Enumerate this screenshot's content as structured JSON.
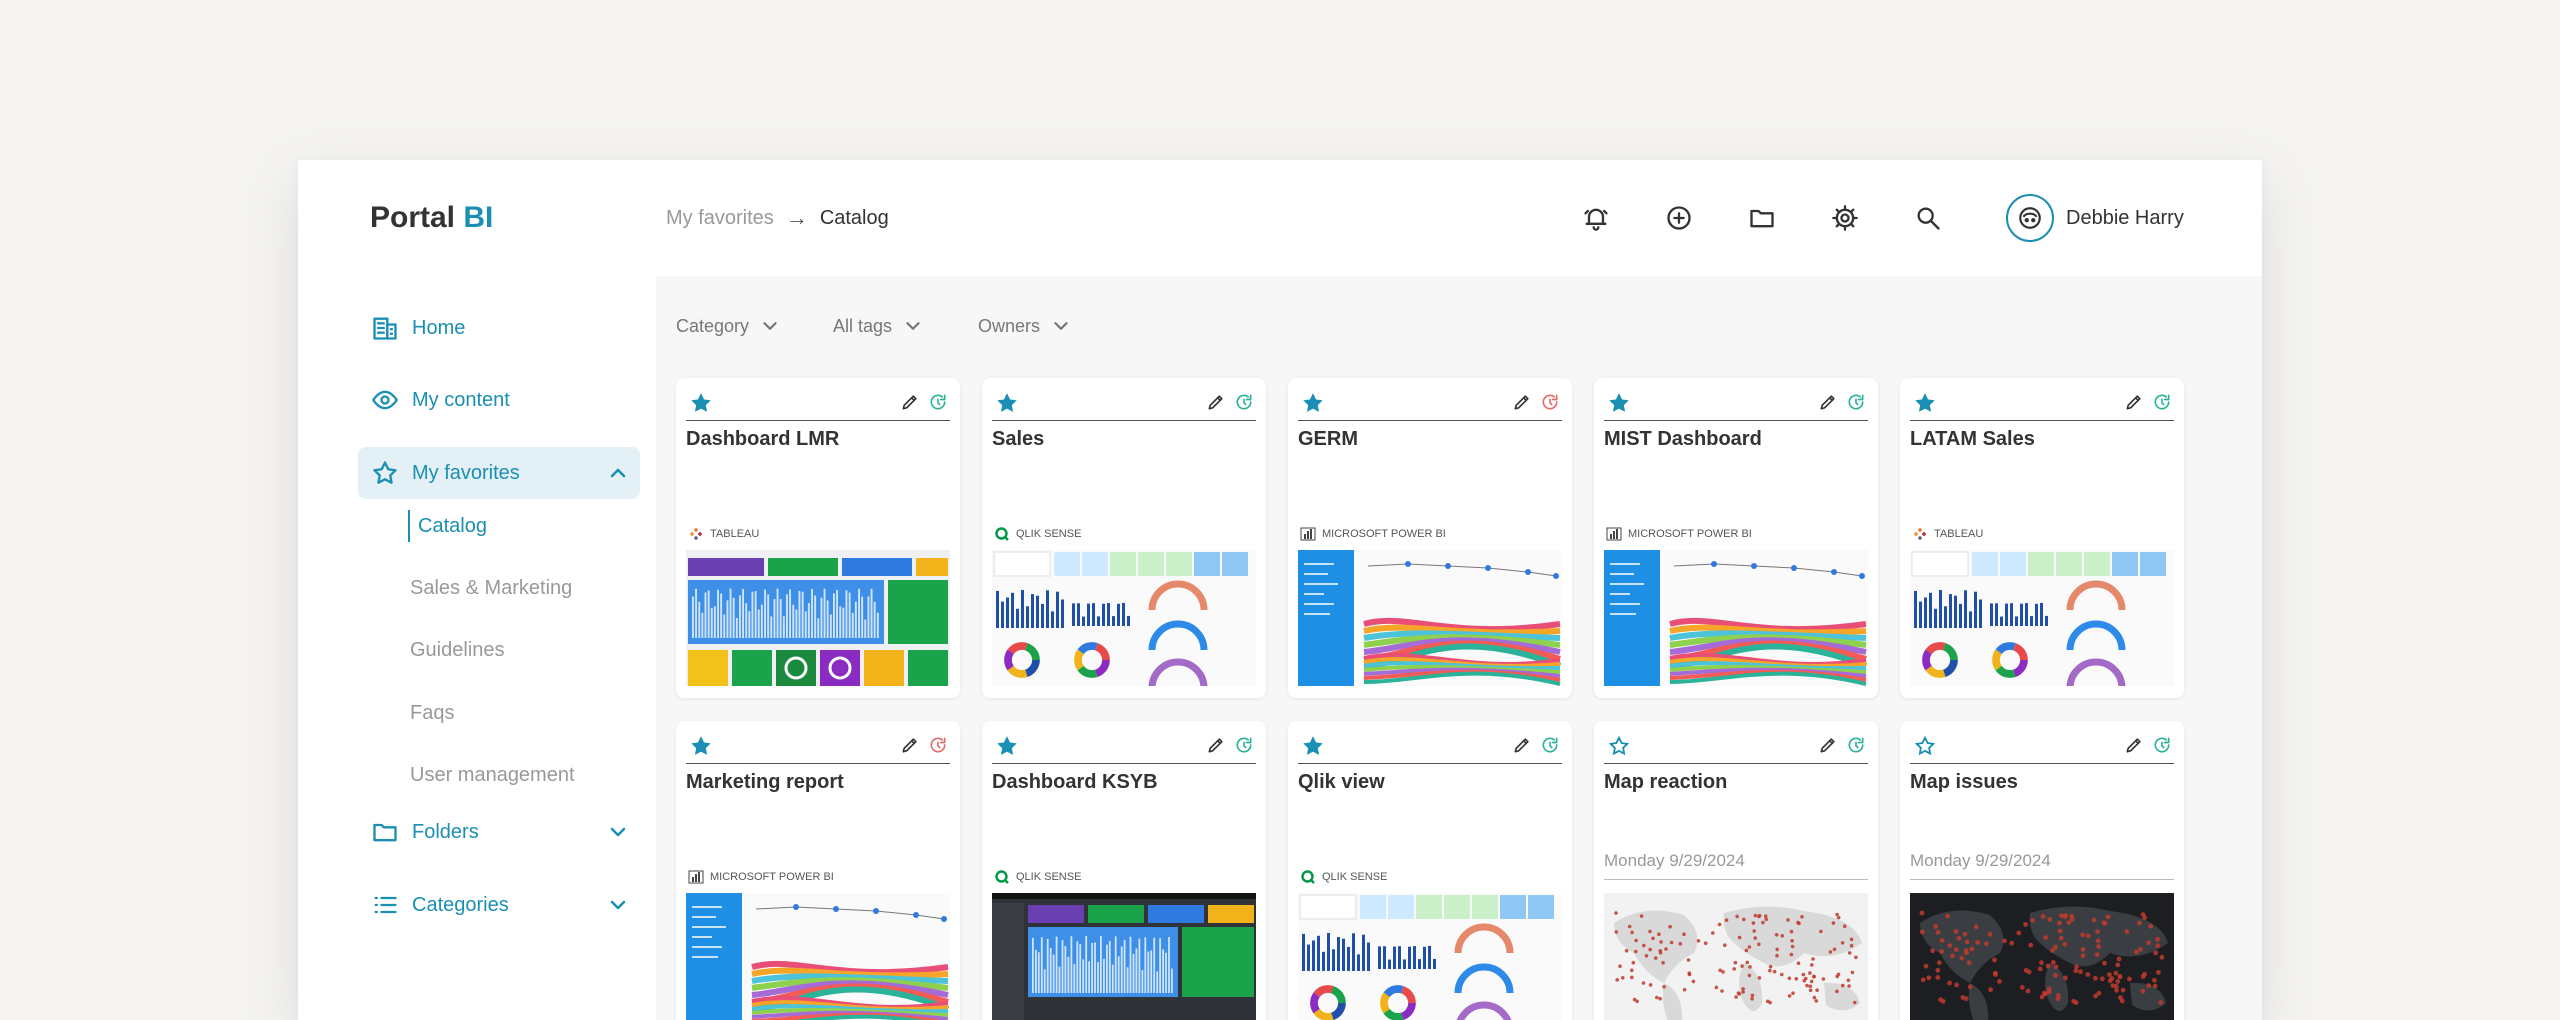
{
  "header": {
    "logo_main": "Portal",
    "logo_accent": "BI",
    "breadcrumb": {
      "parent": "My favorites",
      "arrow": "→",
      "current": "Catalog"
    },
    "user_name": "Debbie Harry"
  },
  "sidebar": {
    "home": "Home",
    "my_content": "My content",
    "my_favorites": "My favorites",
    "sub_items": [
      "Catalog",
      "Sales & Marketing",
      "Guidelines",
      "Faqs",
      "User management"
    ],
    "folders": "Folders",
    "categories": "Categories"
  },
  "filters": {
    "category": "Category",
    "tags": "All tags",
    "owners": "Owners"
  },
  "colors": {
    "accent": "#1a8fb3",
    "refresh_ok": "#2bb39a",
    "refresh_error": "#e26b6b"
  },
  "cards": [
    {
      "title": "Dashboard LMR",
      "source": "TABLEAU",
      "source_icon": "tableau-icon",
      "starred": true,
      "status": "ok",
      "thumb": "dashboard"
    },
    {
      "title": "Sales",
      "source": "QLIK SENSE",
      "source_icon": "qlik-icon",
      "starred": true,
      "status": "ok",
      "thumb": "sales"
    },
    {
      "title": "GERM",
      "source": "MICROSOFT POWER BI",
      "source_icon": "powerbi-icon",
      "starred": true,
      "status": "error",
      "thumb": "powerbi"
    },
    {
      "title": "MIST Dashboard",
      "source": "MICROSOFT POWER BI",
      "source_icon": "powerbi-icon",
      "starred": true,
      "status": "ok",
      "thumb": "powerbi"
    },
    {
      "title": "LATAM Sales",
      "source": "TABLEAU",
      "source_icon": "tableau-icon",
      "starred": true,
      "status": "ok",
      "thumb": "sales"
    },
    {
      "title": "Marketing report",
      "source": "MICROSOFT POWER BI",
      "source_icon": "powerbi-icon",
      "starred": true,
      "status": "error",
      "thumb": "powerbi"
    },
    {
      "title": "Dashboard KSYB",
      "source": "QLIK SENSE",
      "source_icon": "qlik-icon",
      "starred": true,
      "status": "ok",
      "thumb": "dark-dashboard"
    },
    {
      "title": "Qlik view",
      "source": "QLIK SENSE",
      "source_icon": "qlik-icon",
      "starred": true,
      "status": "ok",
      "thumb": "sales"
    },
    {
      "title": "Map reaction",
      "date": "Monday 9/29/2024",
      "starred": false,
      "status": "ok",
      "thumb": "map-light"
    },
    {
      "title": "Map issues",
      "date": "Monday 9/29/2024",
      "starred": false,
      "status": "ok",
      "thumb": "map-dark"
    }
  ]
}
